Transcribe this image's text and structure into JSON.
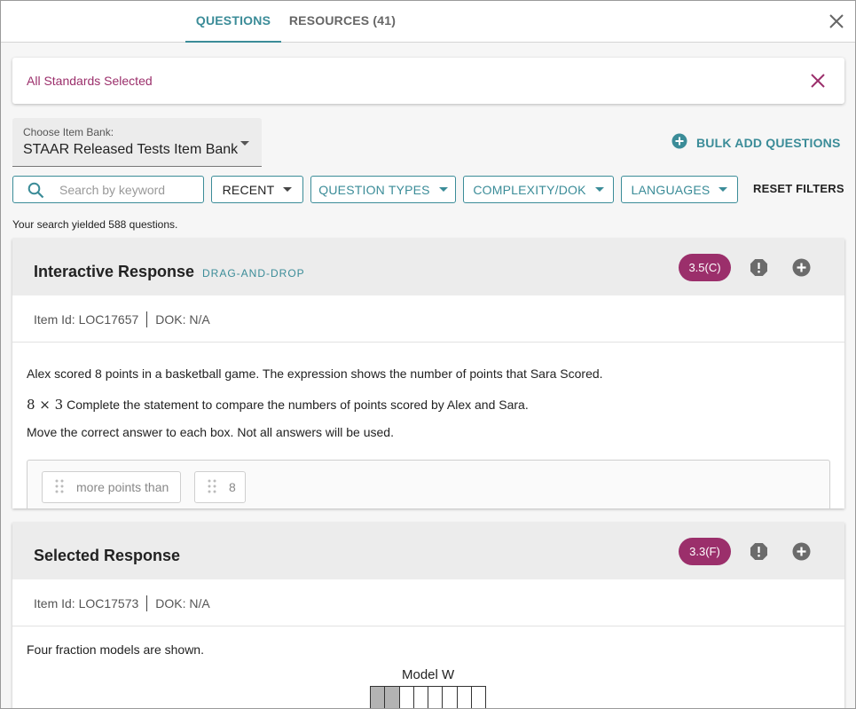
{
  "tabs": [
    {
      "label": "QUESTIONS",
      "active": true
    },
    {
      "label": "RESOURCES (41)",
      "active": false
    }
  ],
  "standards": {
    "label": "All Standards Selected"
  },
  "item_bank": {
    "label": "Choose Item Bank:",
    "value": "STAAR Released Tests Item Bank"
  },
  "bulk_add": {
    "label": "BULK ADD QUESTIONS"
  },
  "search": {
    "placeholder": "Search by keyword",
    "value": ""
  },
  "filters": {
    "recent": "RECENT",
    "question_types": "QUESTION TYPES",
    "complexity": "COMPLEXITY/DOK",
    "languages": "LANGUAGES",
    "reset": "RESET FILTERS"
  },
  "results_text": "Your search yielded 588 questions.",
  "questions": [
    {
      "title": "Interactive Response",
      "subtype": "DRAG-AND-DROP",
      "standard": "3.5(C)",
      "item_id": "Item Id: LOC17657",
      "dok": "DOK: N/A",
      "line1": "Alex scored 8 points in a basketball game. The expression shows the number of points that Sara Scored.",
      "expression": "8 × 3",
      "line2": "Complete the statement to compare the numbers of points scored by Alex and Sara.",
      "line3": "Move the correct answer to each box. Not all answers will be used.",
      "choices": [
        "more points than",
        "8"
      ]
    },
    {
      "title": "Selected Response",
      "subtype": "",
      "standard": "3.3(F)",
      "item_id": "Item Id: LOC17573",
      "dok": "DOK: N/A",
      "line1": "Four fraction models are shown.",
      "model_label": "Model W",
      "model_cells_shaded": [
        true,
        true,
        false,
        false,
        false,
        false,
        false,
        false
      ]
    }
  ],
  "colors": {
    "accent": "#3b8c98",
    "badge": "#9b2f6b",
    "header_bg": "#ececec"
  },
  "icons": [
    "close-icon",
    "plus-circle-icon",
    "search-icon",
    "caret-down-icon",
    "alert-icon",
    "add-icon",
    "drag-handle-icon"
  ]
}
